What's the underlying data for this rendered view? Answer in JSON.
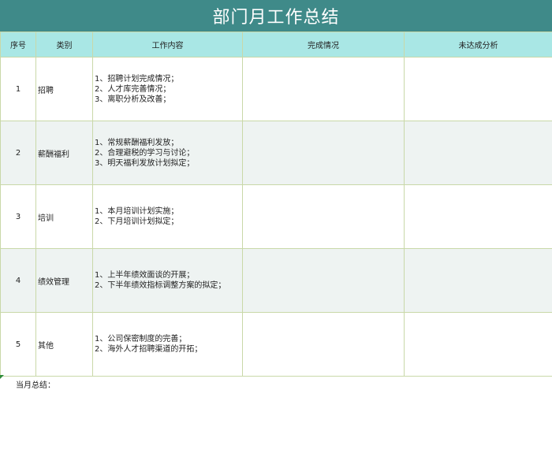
{
  "title": "部门月工作总结",
  "headers": [
    "序号",
    "类别",
    "工作内容",
    "完成情况",
    "未达成分析"
  ],
  "rows": [
    {
      "num": "1",
      "category": "招聘",
      "content": [
        "1、招聘计划完成情况；",
        "2、人才库完善情况；",
        "3、离职分析及改善；"
      ],
      "done": "",
      "analysis": ""
    },
    {
      "num": "2",
      "category": "薪酬福利",
      "content": [
        "1、常规薪酬福利发放；",
        "2、合理避税的学习与讨论；",
        "3、明天福利发放计划拟定；"
      ],
      "done": "",
      "analysis": ""
    },
    {
      "num": "3",
      "category": "培训",
      "content": [
        "1、本月培训计划实施；",
        "2、下月培训计划拟定；"
      ],
      "done": "",
      "analysis": ""
    },
    {
      "num": "4",
      "category": "绩效管理",
      "content": [
        "1、上半年绩效面谈的开展；",
        "2、下半年绩效指标调整方案的拟定；"
      ],
      "done": "",
      "analysis": ""
    },
    {
      "num": "5",
      "category": "其他",
      "content": [
        "1、公司保密制度的完善；",
        "2、海外人才招聘渠道的开拓；"
      ],
      "done": "",
      "analysis": ""
    }
  ],
  "summary_label": "当月总结："
}
